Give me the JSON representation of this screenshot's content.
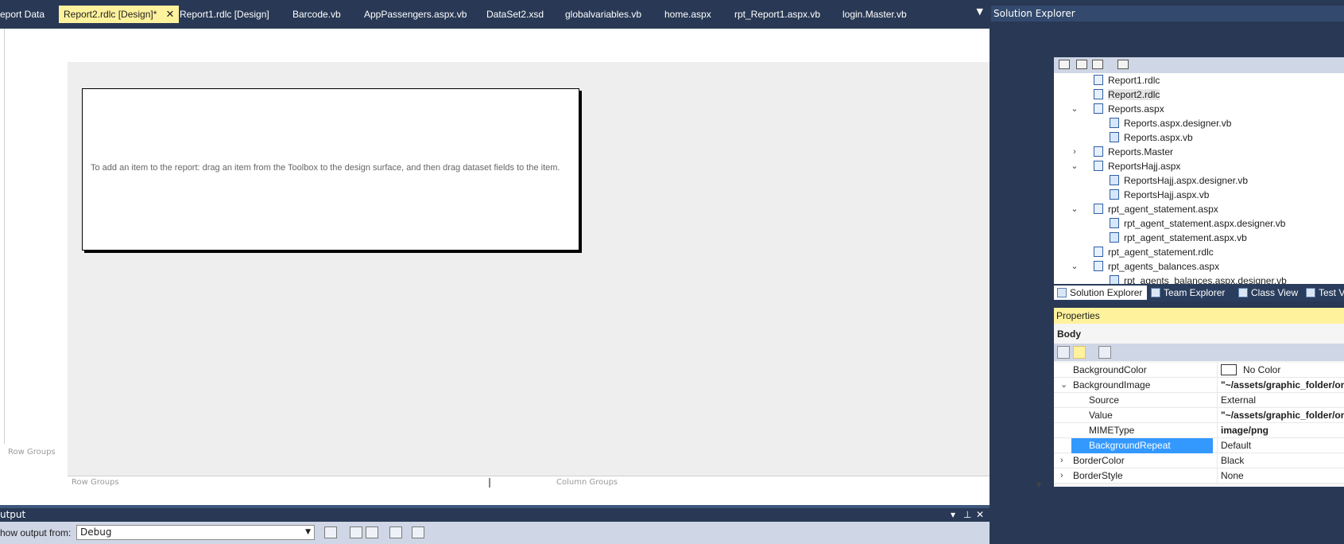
{
  "tabs": [
    {
      "label": "eport Data",
      "active": false
    },
    {
      "label": "Report2.rdlc [Design]*",
      "active": true
    },
    {
      "label": "Report1.rdlc [Design]",
      "active": false
    },
    {
      "label": "Barcode.vb",
      "active": false
    },
    {
      "label": "AppPassengers.aspx.vb",
      "active": false
    },
    {
      "label": "DataSet2.xsd",
      "active": false
    },
    {
      "label": "globalvariables.vb",
      "active": false
    },
    {
      "label": "home.aspx",
      "active": false
    },
    {
      "label": "rpt_Report1.aspx.vb",
      "active": false
    },
    {
      "label": "login.Master.vb",
      "active": false
    }
  ],
  "tab_close_glyph": "✕",
  "tab_overflow_glyph": "▼",
  "designer": {
    "hint": "To add an item to the report: drag an item from the Toolbox to the design surface, and then drag dataset fields to the item.",
    "row_groups_label": "Row Groups",
    "column_groups_label": "Column Groups",
    "left_row_groups": "Row Groups"
  },
  "solution_explorer": {
    "title": "Solution Explorer",
    "items": [
      {
        "label": "Report1.rdlc",
        "expander": "",
        "indent": 1,
        "selected": false
      },
      {
        "label": "Report2.rdlc",
        "expander": "",
        "indent": 1,
        "selected": true
      },
      {
        "label": "Reports.aspx",
        "expander": "⌄",
        "indent": 1,
        "selected": false
      },
      {
        "label": "Reports.aspx.designer.vb",
        "expander": "",
        "indent": 2,
        "selected": false
      },
      {
        "label": "Reports.aspx.vb",
        "expander": "",
        "indent": 2,
        "selected": false
      },
      {
        "label": "Reports.Master",
        "expander": "›",
        "indent": 1,
        "selected": false
      },
      {
        "label": "ReportsHajj.aspx",
        "expander": "⌄",
        "indent": 1,
        "selected": false
      },
      {
        "label": "ReportsHajj.aspx.designer.vb",
        "expander": "",
        "indent": 2,
        "selected": false
      },
      {
        "label": "ReportsHajj.aspx.vb",
        "expander": "",
        "indent": 2,
        "selected": false
      },
      {
        "label": "rpt_agent_statement.aspx",
        "expander": "⌄",
        "indent": 1,
        "selected": false
      },
      {
        "label": "rpt_agent_statement.aspx.designer.vb",
        "expander": "",
        "indent": 2,
        "selected": false
      },
      {
        "label": "rpt_agent_statement.aspx.vb",
        "expander": "",
        "indent": 2,
        "selected": false
      },
      {
        "label": "rpt_agent_statement.rdlc",
        "expander": "",
        "indent": 1,
        "selected": false
      },
      {
        "label": "rpt_agents_balances.aspx",
        "expander": "⌄",
        "indent": 1,
        "selected": false
      },
      {
        "label": "rpt_agents_balances.aspx.designer.vb",
        "expander": "",
        "indent": 2,
        "selected": false
      }
    ],
    "bottom_tabs": [
      {
        "label": "Solution Explorer",
        "active": true
      },
      {
        "label": "Team Explorer",
        "active": false
      },
      {
        "label": "Class View",
        "active": false
      },
      {
        "label": "Test V",
        "active": false
      }
    ]
  },
  "properties": {
    "title": "Properties",
    "object": "Body",
    "rows": [
      {
        "name": "BackgroundColor",
        "value": "No Color",
        "expander": "",
        "child": false,
        "bold": false,
        "swatch": true,
        "selected": false
      },
      {
        "name": "BackgroundImage",
        "value": "\"~/assets/graphic_folder/one",
        "expander": "⌄",
        "child": false,
        "bold": true,
        "swatch": false,
        "selected": false
      },
      {
        "name": "Source",
        "value": "External",
        "expander": "",
        "child": true,
        "bold": false,
        "swatch": false,
        "selected": false
      },
      {
        "name": "Value",
        "value": "\"~/assets/graphic_folder/one",
        "expander": "",
        "child": true,
        "bold": true,
        "swatch": false,
        "selected": false
      },
      {
        "name": "MIMEType",
        "value": "image/png",
        "expander": "",
        "child": true,
        "bold": true,
        "swatch": false,
        "selected": false
      },
      {
        "name": "BackgroundRepeat",
        "value": "Default",
        "expander": "",
        "child": true,
        "bold": false,
        "swatch": false,
        "selected": true
      },
      {
        "name": "BorderColor",
        "value": "Black",
        "expander": "›",
        "child": false,
        "bold": false,
        "swatch": false,
        "selected": false
      },
      {
        "name": "BorderStyle",
        "value": "None",
        "expander": "›",
        "child": false,
        "bold": false,
        "swatch": false,
        "selected": false
      }
    ]
  },
  "output": {
    "title": "utput",
    "show_output_label": "how output from:",
    "show_output_value": "Debug",
    "controls": [
      "▾",
      "⊥",
      "✕"
    ]
  },
  "colors": {
    "chrome": "#293955",
    "active_tab": "#fff29d",
    "selection": "#3399ff",
    "canvas": "#eeeeee"
  }
}
